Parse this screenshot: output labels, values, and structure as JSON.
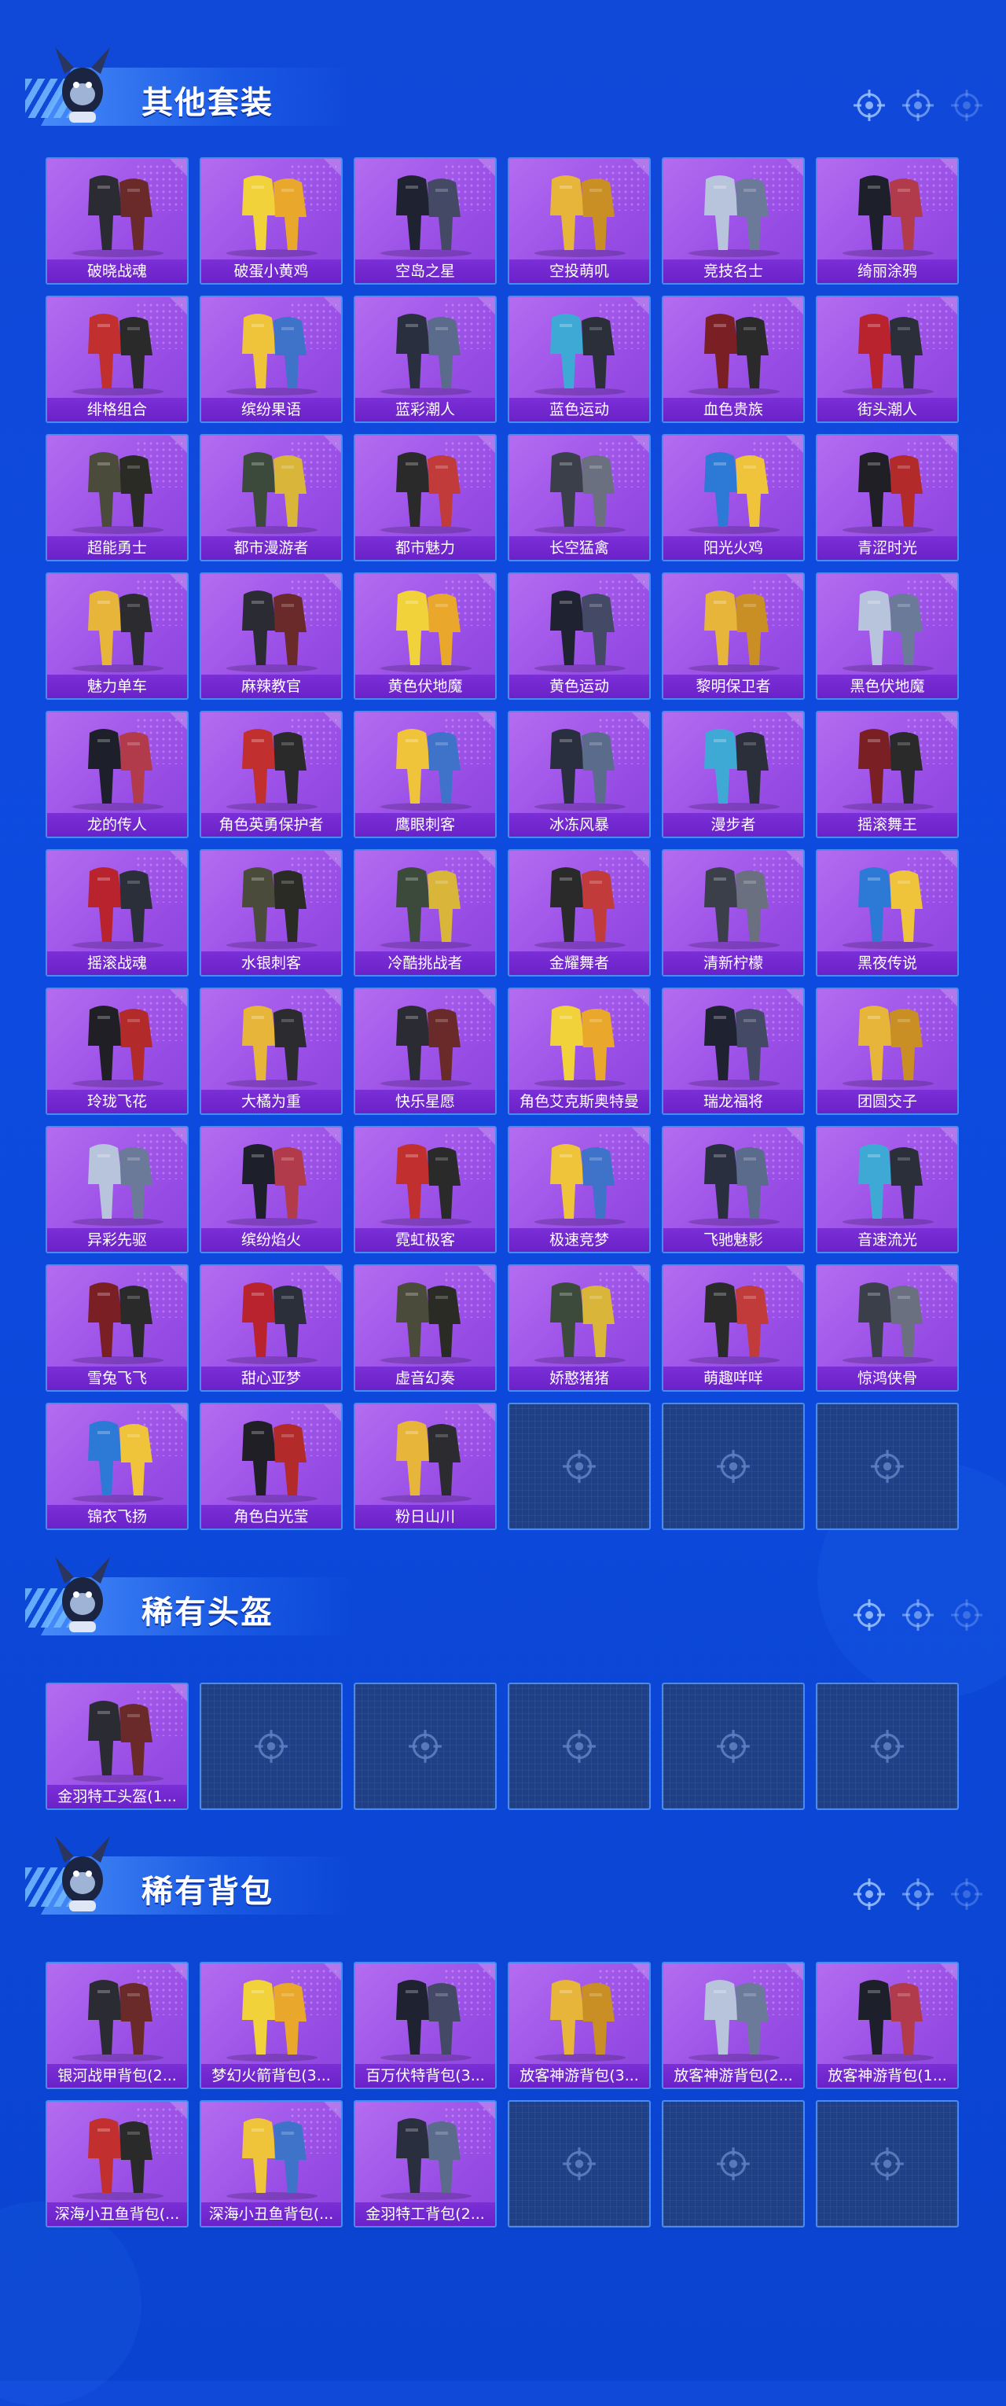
{
  "colors": {
    "card_bg": "#a65ae8",
    "card_label_bg": "#6f26cc",
    "empty_bg": "#1f3f86",
    "page_bg": "#0d4be0",
    "border": "#4a8bf0"
  },
  "sections": [
    {
      "title": "其他套装",
      "items": [
        "破晓战魂",
        "破蛋小黄鸡",
        "空岛之星",
        "空投萌叽",
        "竞技名士",
        "绮丽涂鸦",
        "绯格组合",
        "缤纷果语",
        "蓝彩潮人",
        "蓝色运动",
        "血色贵族",
        "街头潮人",
        "超能勇士",
        "都市漫游者",
        "都市魅力",
        "长空猛禽",
        "阳光火鸡",
        "青涩时光",
        "魅力单车",
        "麻辣教官",
        "黄色伏地魔",
        "黄色运动",
        "黎明保卫者",
        "黑色伏地魔",
        "龙的传人",
        "角色英勇保护者",
        "鹰眼刺客",
        "冰冻风暴",
        "漫步者",
        "摇滚舞王",
        "摇滚战魂",
        "水银刺客",
        "冷酷挑战者",
        "金耀舞者",
        "清新柠檬",
        "黑夜传说",
        "玲珑飞花",
        "大橘为重",
        "快乐星愿",
        "角色艾克斯奥特曼",
        "瑞龙福将",
        "团圆交子",
        "异彩先驱",
        "缤纷焰火",
        "霓虹极客",
        "极速竞梦",
        "飞驰魅影",
        "音速流光",
        "雪兔飞飞",
        "甜心亚梦",
        "虚音幻奏",
        "娇憨猪猪",
        "萌趣咩咩",
        "惊鸿侠骨",
        "锦衣飞扬",
        "角色白光莹",
        "粉日山川"
      ],
      "empty_slots": 3
    },
    {
      "title": "稀有头盔",
      "items": [
        "金羽特工头盔(1..."
      ],
      "empty_slots": 5
    },
    {
      "title": "稀有背包",
      "items": [
        "银河战甲背包(2...",
        "梦幻火箭背包(3...",
        "百万伏特背包(3...",
        "放客神游背包(3...",
        "放客神游背包(2...",
        "放客神游背包(1...",
        "深海小丑鱼背包(...",
        "深海小丑鱼背包(...",
        "金羽特工背包(2..."
      ],
      "empty_slots": 3
    }
  ],
  "icons": {
    "section_marker": "mascot-icon",
    "header_decoration": "crosshair-icon",
    "empty_slot": "crosshair-icon"
  }
}
